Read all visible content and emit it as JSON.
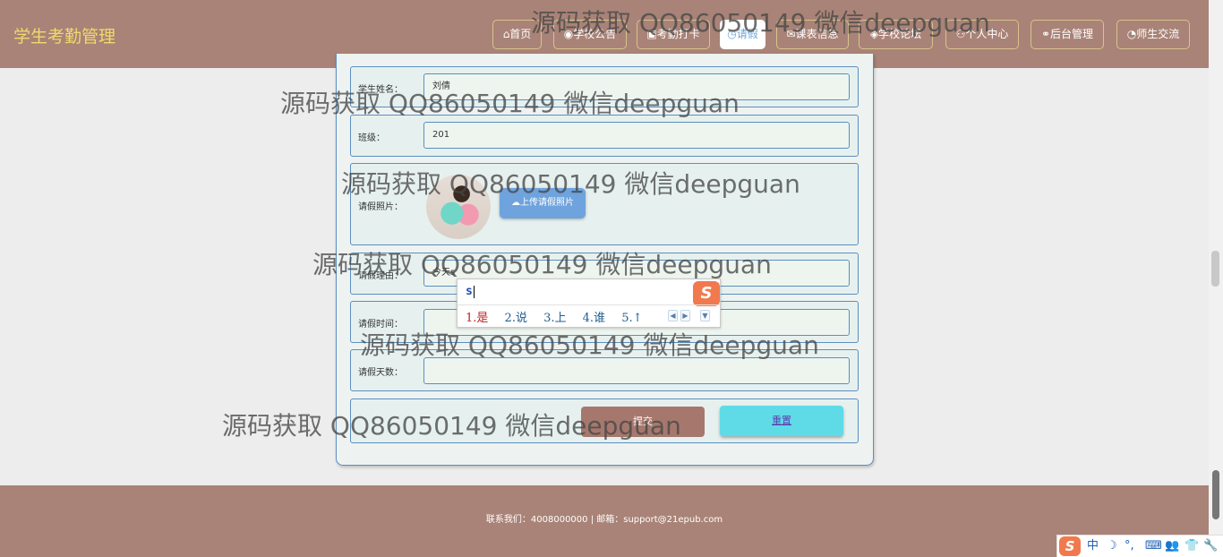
{
  "header": {
    "site_title": "学生考勤管理",
    "nav": [
      {
        "label": "⌂首页",
        "active": false
      },
      {
        "label": "◉学校公告",
        "active": false
      },
      {
        "label": "▣考勤打卡",
        "active": false
      },
      {
        "label": "◷请假",
        "active": true
      },
      {
        "label": "✉课表信息",
        "active": false
      },
      {
        "label": "◈学校论坛",
        "active": false
      },
      {
        "label": "⚇个人中心",
        "active": false
      },
      {
        "label": "⚭后台管理",
        "active": false
      },
      {
        "label": "◔师生交流",
        "active": false
      }
    ]
  },
  "form": {
    "student_name_label": "学生姓名：",
    "student_name_value": "刘倩",
    "class_label": "班级：",
    "class_value": "201",
    "photo_label": "请假照片：",
    "upload_label": "上传请假照片",
    "reason_label": "请假理由：",
    "reason_value": "今天s",
    "time_label": "请假时间：",
    "time_value": "",
    "days_label": "请假天数：",
    "days_value": "",
    "submit_label": "提交",
    "reset_label": "重置"
  },
  "footer": {
    "text": "联系我们：4008000000 | 邮箱：support@21epub.com"
  },
  "ime": {
    "input": "s",
    "logo": "S",
    "candidates": [
      "1.是",
      "2.说",
      "3.上",
      "4.谁",
      "5.↑"
    ]
  },
  "tray": {
    "logo": "S",
    "items": [
      "中",
      "☽",
      "°,",
      "⌨",
      "👥",
      "👕",
      "🔧"
    ]
  },
  "watermark": {
    "text": "源码获取 QQ86050149 微信deepguan"
  },
  "colors": {
    "header_bg": "#a98377",
    "title_color": "#f2d86e",
    "border_blue": "#5b8fbf",
    "upload_btn": "#6ea3dd",
    "reset_btn": "#5fdbe8"
  },
  "icons": {
    "upload": "cloud-upload-icon",
    "ime_logo": "sogou-icon"
  }
}
